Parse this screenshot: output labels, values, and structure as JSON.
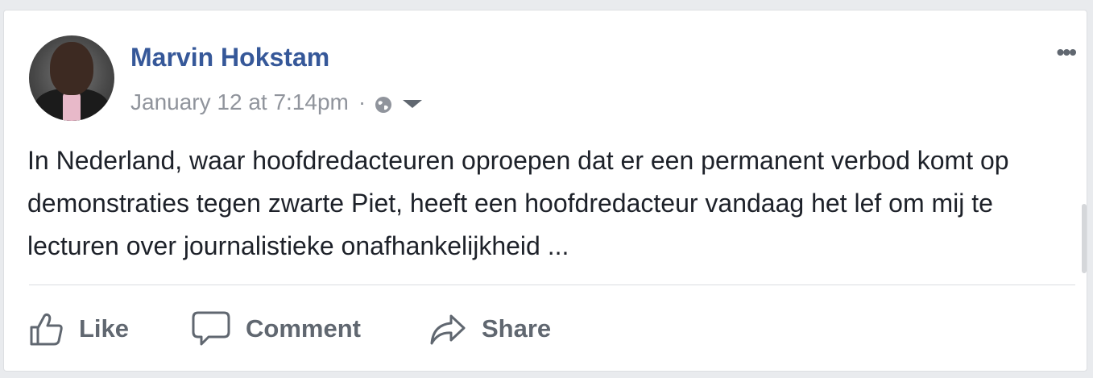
{
  "post": {
    "author": "Marvin Hokstam",
    "timestamp": "January 12 at 7:14pm",
    "separator": "·",
    "privacy_icon": "globe-icon",
    "more_label": "•••",
    "text": "In Nederland, waar hoofdredacteuren oproepen dat er een permanent verbod komt op demonstraties tegen zwarte Piet, heeft een hoofdredacteur vandaag het lef om mij te lecturen over journalistieke onafhankelijkheid ..."
  },
  "actions": {
    "like": "Like",
    "comment": "Comment",
    "share": "Share"
  },
  "colors": {
    "author_link": "#365899",
    "meta_text": "#90949c",
    "action_text": "#606770",
    "body_text": "#1d2129"
  }
}
